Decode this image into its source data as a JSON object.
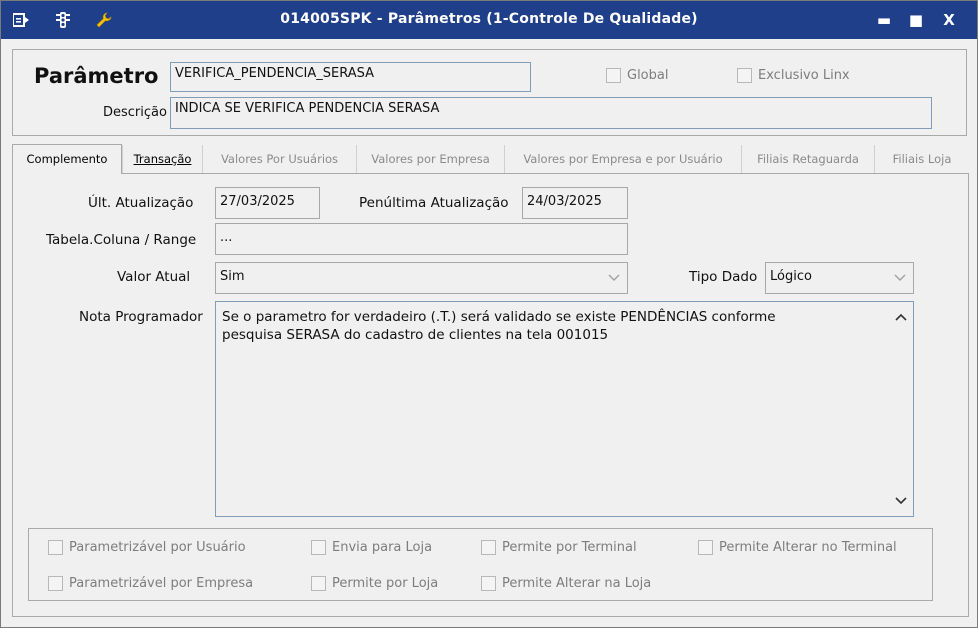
{
  "window": {
    "title": "014005SPK - Parâmetros (1-Controle De Qualidade)",
    "title_bar_color": "#1f3f8a",
    "icons": [
      "menu-icon",
      "traffic-light-icon",
      "wrench-icon"
    ],
    "controls": {
      "minimize": "▬",
      "maximize": "■",
      "close": "X"
    }
  },
  "header": {
    "parametro_label": "Parâmetro",
    "parametro_value": "VERIFICA_PENDENCIA_SERASA",
    "descricao_label": "Descrição",
    "descricao_value": "INDICA SE VERIFICA PENDENCIA SERASA",
    "global_label": "Global",
    "exclusivo_label": "Exclusivo Linx"
  },
  "tabs": [
    {
      "label": "Complemento",
      "active": true
    },
    {
      "label": "Transação",
      "active": false
    },
    {
      "label": "Valores Por Usuários",
      "active": false
    },
    {
      "label": "Valores por Empresa",
      "active": false
    },
    {
      "label": "Valores por Empresa e por Usuário",
      "active": false
    },
    {
      "label": "Filiais Retaguarda",
      "active": false
    },
    {
      "label": "Filiais Loja",
      "active": false
    }
  ],
  "complemento": {
    "ult_atualizacao_label": "Últ. Atualização",
    "ult_atualizacao_value": "27/03/2025",
    "penultima_label": "Penúltima Atualização",
    "penultima_value": "24/03/2025",
    "tabela_label": "Tabela.Coluna / Range",
    "tabela_value": "...",
    "valor_atual_label": "Valor Atual",
    "valor_atual_value": "Sim",
    "tipo_dado_label": "Tipo Dado",
    "tipo_dado_value": "Lógico",
    "nota_label": "Nota Programador",
    "nota_value": "Se o parametro for verdadeiro (.T.) será validado se existe PENDÊNCIAS conforme\npesquisa SERASA do cadastro de clientes na tela 001015"
  },
  "checkboxes": {
    "parametrizavel_usuario": "Parametrizável por Usuário",
    "envia_loja": "Envia para Loja",
    "permite_terminal": "Permite por Terminal",
    "permite_alterar_terminal": "Permite Alterar no Terminal",
    "parametrizavel_empresa": "Parametrizável por Empresa",
    "permite_loja": "Permite por Loja",
    "permite_alterar_loja": "Permite Alterar na Loja"
  }
}
